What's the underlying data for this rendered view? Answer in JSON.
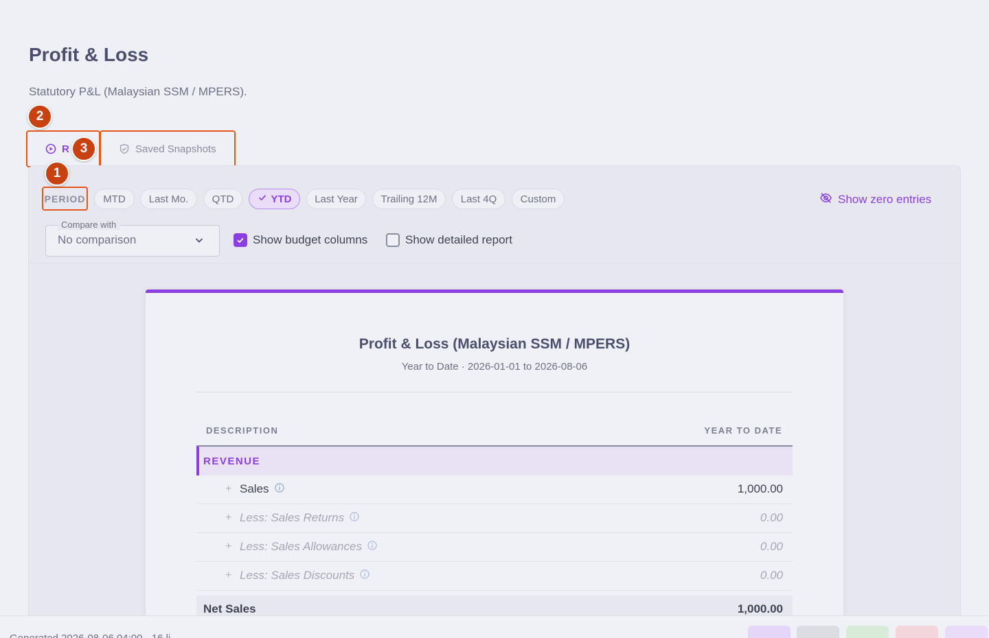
{
  "page": {
    "title": "Profit & Loss",
    "subtitle": "Statutory P&L (Malaysian SSM / MPERS)."
  },
  "tabs": [
    {
      "label": "R",
      "icon": "play-circle-icon"
    },
    {
      "label": "Saved Snapshots",
      "icon": "shield-check-icon"
    }
  ],
  "markers": [
    "1",
    "2",
    "3"
  ],
  "period": {
    "label": "PERIOD",
    "options": [
      "MTD",
      "Last Mo.",
      "QTD",
      "YTD",
      "Last Year",
      "Trailing 12M",
      "Last 4Q",
      "Custom"
    ],
    "selected": "YTD"
  },
  "show_zero": {
    "label": "Show zero entries",
    "icon": "eye-off-icon"
  },
  "compare": {
    "legend": "Compare with",
    "value": "No comparison"
  },
  "checkboxes": {
    "budget": {
      "label": "Show budget columns",
      "checked": true
    },
    "detailed": {
      "label": "Show detailed report",
      "checked": false
    }
  },
  "report": {
    "title": "Profit & Loss (Malaysian SSM / MPERS)",
    "subtitle": "Year to Date · 2026-01-01 to 2026-08-06",
    "col_desc": "DESCRIPTION",
    "col_amount": "YEAR TO DATE",
    "section": "REVENUE",
    "rows": [
      {
        "label": "Sales",
        "amount": "1,000.00",
        "muted": false
      },
      {
        "label": "Less: Sales Returns",
        "amount": "0.00",
        "muted": true
      },
      {
        "label": "Less: Sales Allowances",
        "amount": "0.00",
        "muted": true
      },
      {
        "label": "Less: Sales Discounts",
        "amount": "0.00",
        "muted": true
      }
    ],
    "total": {
      "label": "Net Sales",
      "amount": "1,000.00"
    }
  },
  "footer": {
    "text": "Generated 2026-08-06 04:00 · 16 li",
    "button_colors": [
      "#e3d6f8",
      "#dcdde3",
      "#d8ebd9",
      "#f3d6db",
      "#e8dcf8"
    ]
  },
  "colors": {
    "accent": "#8b3fe0",
    "marker": "#c84111"
  }
}
